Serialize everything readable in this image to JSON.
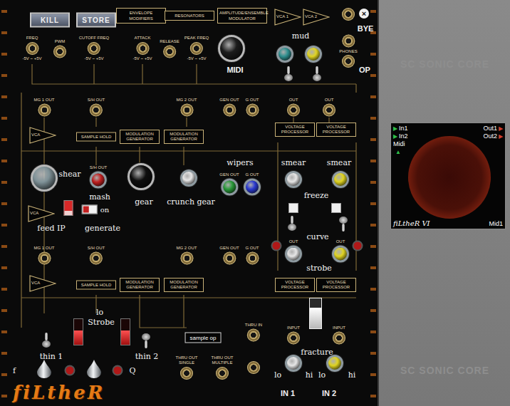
{
  "panel": {
    "logo": "fiLtheR"
  },
  "watermarks": [
    "SC SONIC CORE",
    "SC SONIC CORE"
  ],
  "controls": [
    {
      "kind": "button",
      "label": "KILL"
    },
    {
      "kind": "button",
      "label": "STORE"
    },
    {
      "kind": "header",
      "label": "ENVELOPE MODIFIERS"
    },
    {
      "kind": "header",
      "label": "RESONATORS"
    },
    {
      "kind": "header",
      "label": "AMPLITUDE/ENSEMBLE MODULATOR"
    },
    {
      "kind": "vca",
      "label": "VCA 1"
    },
    {
      "kind": "vca",
      "label": "VCA 2"
    },
    {
      "kind": "jack"
    },
    {
      "kind": "close",
      "label": "×"
    },
    {
      "kind": "title",
      "label": "BYE"
    },
    {
      "kind": "jack",
      "sub": "PHONES"
    },
    {
      "kind": "jack"
    },
    {
      "kind": "title",
      "label": "OP"
    },
    {
      "kind": "jack",
      "label": "FREQ",
      "sub": "-5V ~ +5V"
    },
    {
      "kind": "jack",
      "label": "PWM"
    },
    {
      "kind": "jack",
      "label": "CUTOFF FREQ",
      "sub": "-5V ~ +5V"
    },
    {
      "kind": "jack",
      "label": "ATTACK",
      "sub": "-5V ~ +5V"
    },
    {
      "kind": "jack",
      "label": "RELEASE"
    },
    {
      "kind": "jack",
      "label": "PEAK FREQ",
      "sub": "-5V ~ +5V"
    },
    {
      "kind": "bigknob",
      "color": "#1c1c1c"
    },
    {
      "kind": "title",
      "label": "MIDI"
    },
    {
      "kind": "label",
      "label": "mud"
    },
    {
      "kind": "knob",
      "color": "#2f8f8f"
    },
    {
      "kind": "knob",
      "color": "#e0d422"
    },
    {
      "kind": "switch",
      "on": true
    },
    {
      "kind": "switch",
      "on": true
    },
    {
      "kind": "jack",
      "label": "MG 1 OUT"
    },
    {
      "kind": "jack",
      "label": "S/H OUT"
    },
    {
      "kind": "jack",
      "label": "MG 2 OUT"
    },
    {
      "kind": "jack",
      "label": "GEN OUT"
    },
    {
      "kind": "jack",
      "label": "G OUT"
    },
    {
      "kind": "jack",
      "label": "OUT"
    },
    {
      "kind": "jack",
      "label": "OUT"
    },
    {
      "kind": "vca",
      "label": "VCA"
    },
    {
      "kind": "box",
      "label": "SAMPLE HOLD"
    },
    {
      "kind": "box",
      "label": "MODULATION GENERATOR"
    },
    {
      "kind": "box",
      "label": "MODULATION GENERATOR"
    },
    {
      "kind": "box",
      "label": "VOLTAGE PROCESSOR"
    },
    {
      "kind": "box",
      "label": "VOLTAGE PROCESSOR"
    },
    {
      "kind": "bigknob",
      "color": "#7f9298"
    },
    {
      "kind": "label",
      "label": "shear"
    },
    {
      "kind": "knob",
      "label": "S/H OUT",
      "color": "#c02020"
    },
    {
      "kind": "label",
      "label": "mash"
    },
    {
      "kind": "bigknob",
      "color": "#0e0e0e"
    },
    {
      "kind": "label",
      "label": "gear"
    },
    {
      "kind": "knob",
      "color": "#e6e6e6"
    },
    {
      "kind": "label",
      "label": "crunch gear"
    },
    {
      "kind": "label",
      "label": "wipers"
    },
    {
      "kind": "knob",
      "label": "GEN OUT",
      "color": "#2a9a3a"
    },
    {
      "kind": "knob",
      "label": "G OUT",
      "color": "#2a3ad0"
    },
    {
      "kind": "label",
      "label": "smear"
    },
    {
      "kind": "label",
      "label": "smear"
    },
    {
      "kind": "knob",
      "color": "#e6e6e6"
    },
    {
      "kind": "knob",
      "color": "#e0d422"
    },
    {
      "kind": "label",
      "label": "freeze"
    },
    {
      "kind": "square",
      "on": false
    },
    {
      "kind": "square",
      "on": false
    },
    {
      "kind": "switch",
      "on": true
    },
    {
      "kind": "switch",
      "on": false
    },
    {
      "kind": "label",
      "label": "curve"
    },
    {
      "kind": "dot",
      "color": "#b01818"
    },
    {
      "kind": "dot",
      "color": "#b01818"
    },
    {
      "kind": "knob",
      "label": "OUT",
      "color": "#e6e6e6"
    },
    {
      "kind": "knob",
      "label": "OUT",
      "color": "#e0d422"
    },
    {
      "kind": "label",
      "label": "strobe"
    },
    {
      "kind": "vca",
      "label": "VCA"
    },
    {
      "kind": "redswitch",
      "on": true
    },
    {
      "kind": "label",
      "label": "feed IP"
    },
    {
      "kind": "toggle",
      "label": "on",
      "on": true
    },
    {
      "kind": "label",
      "label": "generate"
    },
    {
      "kind": "jack",
      "label": "MG 1 OUT"
    },
    {
      "kind": "jack",
      "label": "S/H OUT"
    },
    {
      "kind": "jack",
      "label": "MG 2 OUT"
    },
    {
      "kind": "jack",
      "label": "GEN OUT"
    },
    {
      "kind": "jack",
      "label": "G OUT"
    },
    {
      "kind": "vca",
      "label": "VCA"
    },
    {
      "kind": "box",
      "label": "SAMPLE HOLD"
    },
    {
      "kind": "box",
      "label": "MODULATION GENERATOR"
    },
    {
      "kind": "box",
      "label": "MODULATION GENERATOR"
    },
    {
      "kind": "box",
      "label": "VOLTAGE PROCESSOR"
    },
    {
      "kind": "box",
      "label": "VOLTAGE PROCESSOR"
    },
    {
      "kind": "switch",
      "on": true
    },
    {
      "kind": "label",
      "label": "thin 1"
    },
    {
      "kind": "rslider",
      "level": 0.55
    },
    {
      "kind": "label",
      "label": "lo"
    },
    {
      "kind": "label",
      "label": "Strobe"
    },
    {
      "kind": "rslider",
      "level": 0.55
    },
    {
      "kind": "switch",
      "on": false
    },
    {
      "kind": "label",
      "label": "thin 2"
    },
    {
      "kind": "label",
      "label": "f"
    },
    {
      "kind": "cone"
    },
    {
      "kind": "dot",
      "color": "#b01818"
    },
    {
      "kind": "cone"
    },
    {
      "kind": "dot",
      "color": "#b01818"
    },
    {
      "kind": "label",
      "label": "Q"
    },
    {
      "kind": "opbox",
      "label": "sample op"
    },
    {
      "kind": "jack",
      "label": "THRU IN"
    },
    {
      "kind": "jack",
      "label": "THRU OUT SINGLE"
    },
    {
      "kind": "jack",
      "label": "THRU OUT MULTIPLE"
    },
    {
      "kind": "jack"
    },
    {
      "kind": "vslider",
      "level": 0.7
    },
    {
      "kind": "jack",
      "label": "INPUT"
    },
    {
      "kind": "jack",
      "label": "INPUT"
    },
    {
      "kind": "label",
      "label": "fracture"
    },
    {
      "kind": "knob",
      "color": "#e6e6e6"
    },
    {
      "kind": "knob",
      "color": "#e0d422"
    },
    {
      "kind": "label",
      "label": "lo"
    },
    {
      "kind": "label",
      "label": "hi"
    },
    {
      "kind": "label",
      "label": "lo"
    },
    {
      "kind": "label",
      "label": "hi"
    },
    {
      "kind": "title",
      "label": "IN 1"
    },
    {
      "kind": "title",
      "label": "IN 2"
    }
  ],
  "module": {
    "inputs": [
      {
        "label": "In1",
        "icon": "▶"
      },
      {
        "label": "In2",
        "icon": "▶"
      }
    ],
    "midi_in": {
      "label": "Midi",
      "icon": "▲"
    },
    "outputs": [
      {
        "label": "Out1",
        "icon": "▶"
      },
      {
        "label": "Out2",
        "icon": "▶"
      }
    ],
    "name": "fiLtheR VI",
    "midi_out": "Mid1"
  }
}
